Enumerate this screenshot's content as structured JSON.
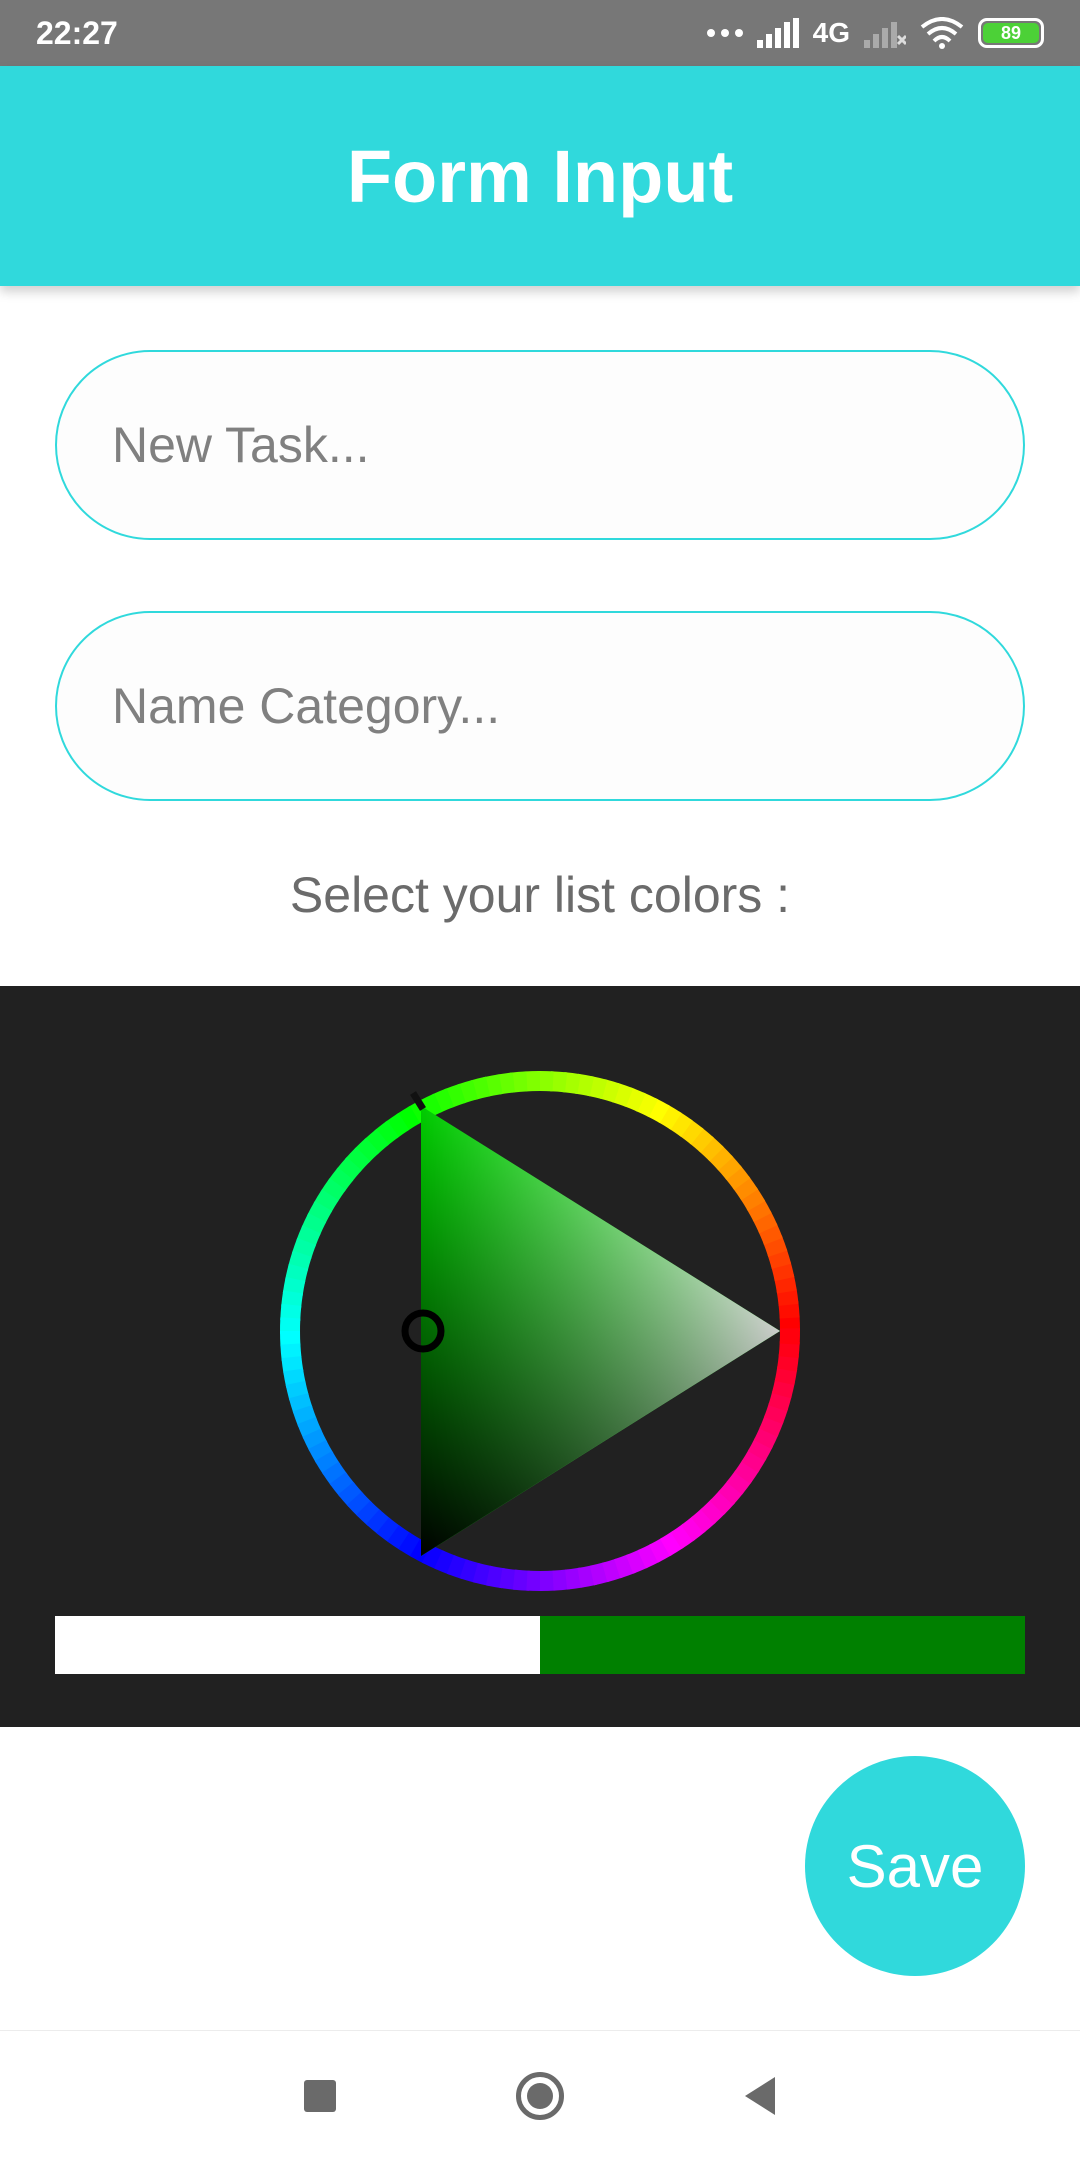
{
  "status_bar": {
    "time": "22:27",
    "network": "4G",
    "battery": "89",
    "icons": [
      "more-dots-icon",
      "signal-icon",
      "signal-off-icon",
      "wifi-icon",
      "battery-icon"
    ]
  },
  "app_bar": {
    "title": "Form Input"
  },
  "task_input": {
    "placeholder": "New Task...",
    "value": ""
  },
  "category_input": {
    "placeholder": "Name Category...",
    "value": ""
  },
  "color_section": {
    "label": "Select your list colors :"
  },
  "color_picker": {
    "hue_color": "#00ff00",
    "old_color": "#ffffff",
    "new_color": "#008000",
    "background": "#212121"
  },
  "save_button": {
    "label": "Save"
  },
  "colors": {
    "accent": "#30d9dc",
    "status_bar": "#777777"
  },
  "nav_bar": {
    "icons": [
      "recents-square-icon",
      "home-circle-icon",
      "back-triangle-icon"
    ]
  }
}
